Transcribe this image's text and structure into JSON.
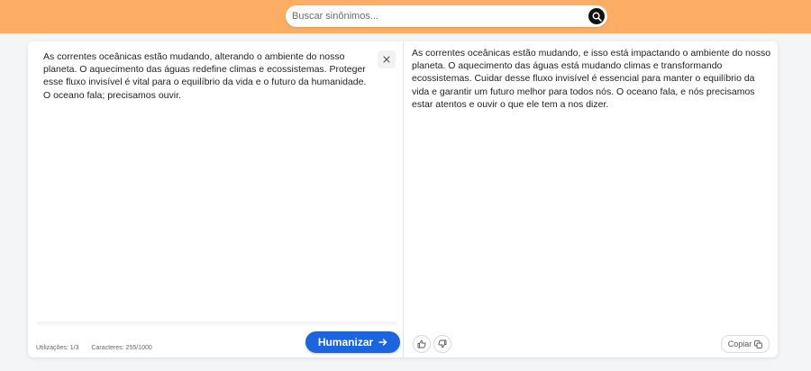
{
  "search": {
    "placeholder": "Buscar sinônimos..."
  },
  "input": {
    "text": "As correntes oceânicas estão mudando, alterando o ambiente do nosso planeta. O aquecimento das águas redefine climas e ecossistemas. Proteger esse fluxo invisível é vital para o equilíbrio da vida e o futuro da humanidade. O oceano fala; precisamos ouvir."
  },
  "output": {
    "text": "As correntes oceânicas estão mudando, e isso está impactando o ambiente do nosso planeta. O aquecimento das águas está mudando climas e transformando ecossistemas. Cuidar desse fluxo invisível é essencial para manter o equilíbrio da vida e garantir um futuro melhor para todos nós. O oceano fala, e nós precisamos estar atentos e ouvir o que ele tem a nos dizer."
  },
  "stats": {
    "uses": "Utilizações: 1/3",
    "chars": "Caracteres: 255/1000"
  },
  "buttons": {
    "humanize": "Humanizar",
    "copy": "Copiar"
  },
  "icons": {
    "search": "search-icon",
    "clear": "close-icon",
    "humanize": "arrow-right-icon",
    "like": "thumbs-up-icon",
    "dislike": "thumbs-down-icon",
    "copy": "copy-icon"
  },
  "colors": {
    "topbar": "#fdad64",
    "accent": "#1b66e0",
    "background": "#f4f5f7"
  }
}
